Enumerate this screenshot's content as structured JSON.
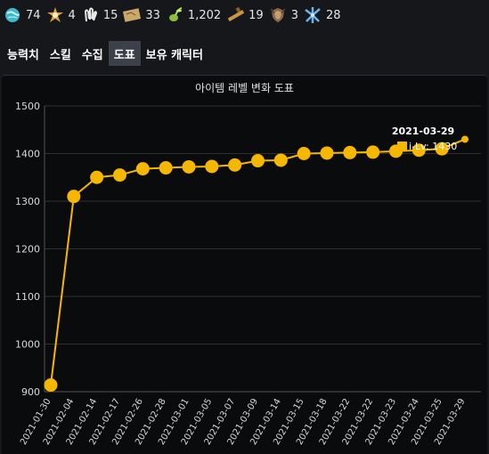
{
  "resources": [
    {
      "icon": "globe-icon",
      "value": "74"
    },
    {
      "icon": "star-flower-icon",
      "value": "4"
    },
    {
      "icon": "claw-icon",
      "value": "15"
    },
    {
      "icon": "map-scroll-icon",
      "value": "33"
    },
    {
      "icon": "seed-icon",
      "value": "1,202"
    },
    {
      "icon": "telescope-icon",
      "value": "19"
    },
    {
      "icon": "shield-crest-icon",
      "value": "3"
    },
    {
      "icon": "leaf-icon",
      "value": "28"
    }
  ],
  "tabs": [
    {
      "label": "능력치",
      "active": false
    },
    {
      "label": "스킬",
      "active": false
    },
    {
      "label": "수집",
      "active": false
    },
    {
      "label": "도표",
      "active": true
    },
    {
      "label": "보유 캐릭터",
      "active": false
    }
  ],
  "colors": {
    "line": "#f5b700",
    "background": "#0a0b0d",
    "grid": "#2e3035"
  },
  "chart_data": {
    "type": "line",
    "title": "아이템 레벨 변화 도표",
    "x": [
      "2021-01-30",
      "2021-02-04",
      "2021-02-14",
      "2021-02-17",
      "2021-02-26",
      "2021-02-28",
      "2021-03-01",
      "2021-03-05",
      "2021-03-07",
      "2021-03-09",
      "2021-03-14",
      "2021-03-15",
      "2021-03-18",
      "2021-03-22",
      "2021-03-22",
      "2021-03-23",
      "2021-03-24",
      "2021-03-25",
      "2021-03-29"
    ],
    "series": [
      {
        "name": "i-Lv",
        "values": [
          914,
          1310,
          1350,
          1355,
          1368,
          1370,
          1372,
          1373,
          1376,
          1385,
          1386,
          1400,
          1401,
          1402,
          1403,
          1405,
          1407,
          1410,
          1430
        ]
      }
    ],
    "ylim": [
      900,
      1500
    ],
    "yticks": [
      900,
      1000,
      1100,
      1200,
      1300,
      1400,
      1500
    ],
    "grid": true,
    "tooltip": {
      "date": "2021-03-29",
      "label": "i-Lv: 1430"
    }
  }
}
